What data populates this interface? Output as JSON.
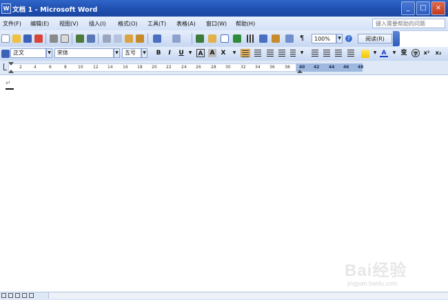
{
  "window": {
    "title": "文档 1 - Microsoft Word",
    "app_icon": "W",
    "buttons": [
      "_",
      "□",
      "×"
    ]
  },
  "menu": {
    "items": [
      "文件(F)",
      "编辑(E)",
      "视图(V)",
      "插入(I)",
      "格式(O)",
      "工具(T)",
      "表格(A)",
      "窗口(W)",
      "帮助(H)"
    ],
    "help_placeholder": "键入需要帮助的问题"
  },
  "standard_toolbar": {
    "zoom": "100%",
    "reading_button": "阅读(R)",
    "icons": [
      "new-icon",
      "open-icon",
      "save-icon",
      "permission-icon",
      "print-icon",
      "print-preview-icon",
      "spelling-icon",
      "research-icon",
      "cut-icon",
      "copy-icon",
      "paste-icon",
      "format-painter-icon",
      "undo-icon",
      "redo-icon",
      "hyperlink-icon",
      "tables-borders-icon",
      "insert-table-icon",
      "insert-excel-icon",
      "columns-icon",
      "drawing-icon",
      "document-map-icon",
      "show-hide-icon"
    ]
  },
  "formatting_toolbar": {
    "style": "正文",
    "font": "宋体",
    "size": "五号",
    "bold": "B",
    "italic": "I",
    "underline": "U",
    "char_border": "A",
    "char_shading": "A",
    "char_scale": "X",
    "phonetic": "变",
    "superscript": "x²",
    "subscript": "x₂"
  },
  "ruler": {
    "ticks": [
      "2",
      "4",
      "6",
      "8",
      "10",
      "12",
      "14",
      "16",
      "18",
      "20",
      "22",
      "24",
      "26",
      "28",
      "30",
      "32",
      "34",
      "36",
      "38",
      "40",
      "42",
      "44",
      "46",
      "48"
    ]
  },
  "document": {
    "paragraph_mark": "↵"
  },
  "watermark": {
    "text": "Bai经验",
    "url": "jingyan.baidu.com"
  },
  "colors": {
    "titlebar": "#1f4fb0",
    "toolbar": "#c6d7f2",
    "highlight": "#f6c467"
  }
}
